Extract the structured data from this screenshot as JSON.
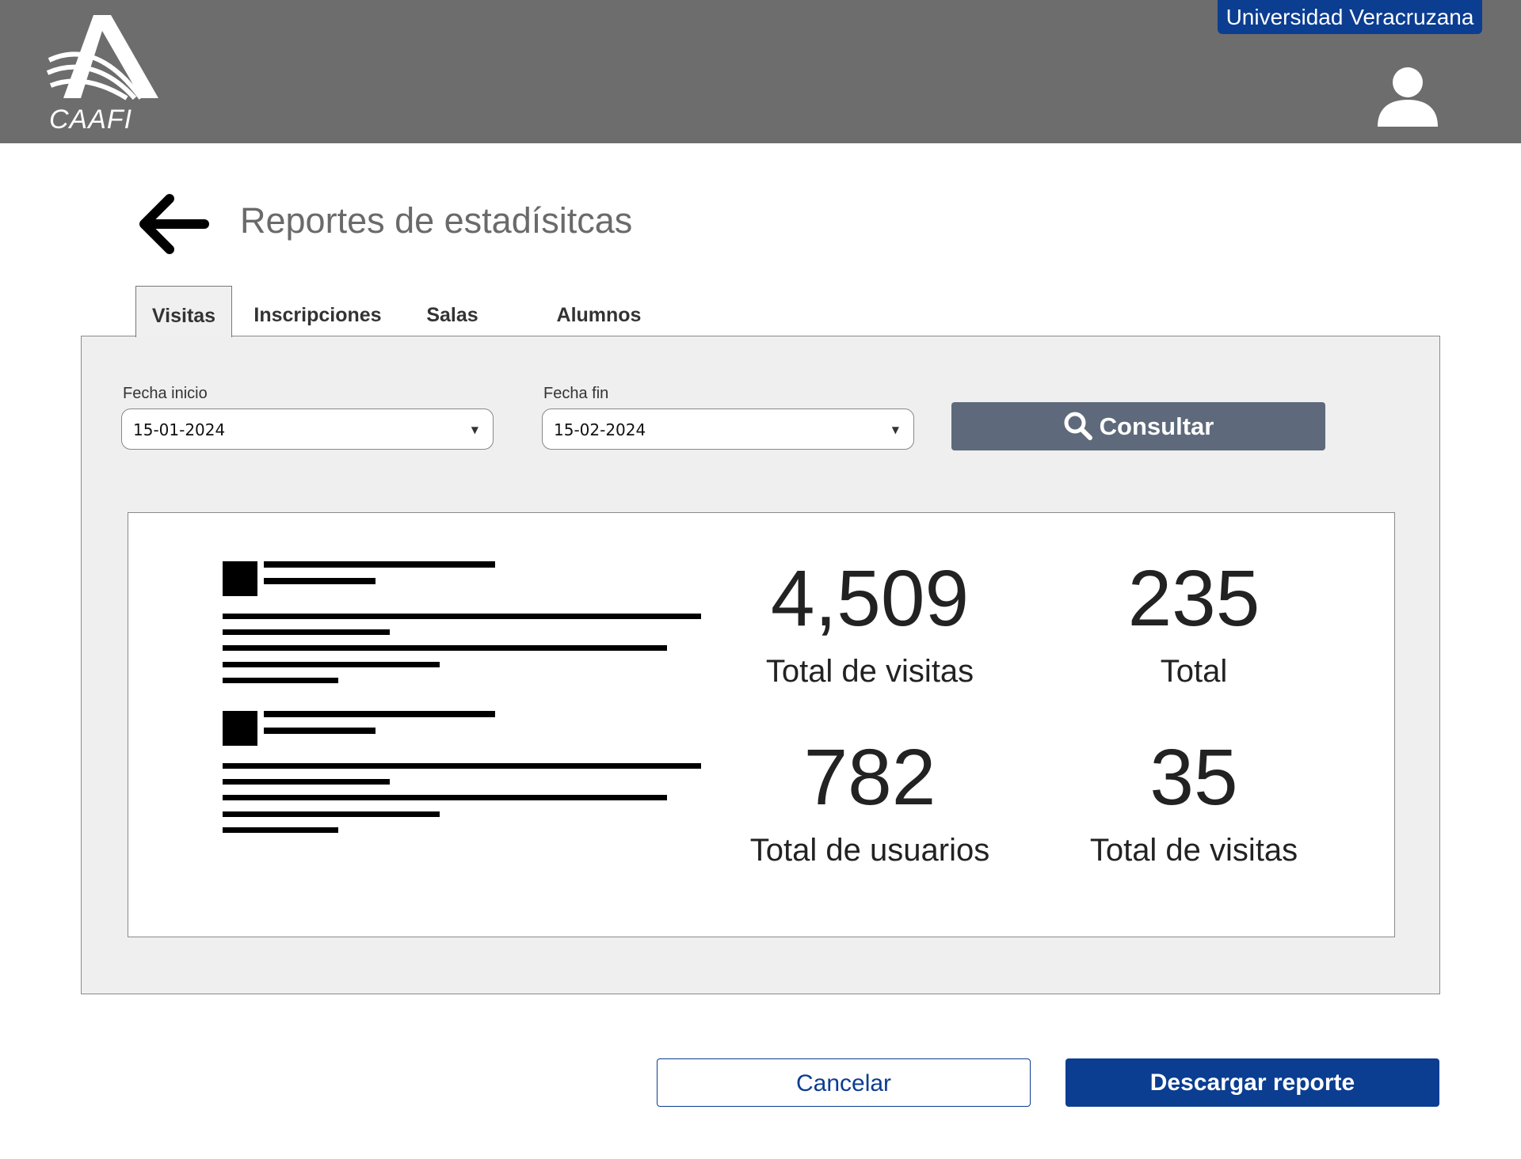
{
  "header": {
    "logo_text": "CAAFI",
    "university": "Universidad Veracruzana"
  },
  "page": {
    "title": "Reportes de estadísitcas"
  },
  "tabs": [
    {
      "label": "Visitas",
      "active": true
    },
    {
      "label": "Inscripciones",
      "active": false
    },
    {
      "label": "Salas",
      "active": false
    },
    {
      "label": "Alumnos",
      "active": false
    }
  ],
  "filters": {
    "start_label": "Fecha inicio",
    "start_value": "15-01-2024",
    "end_label": "Fecha fin",
    "end_value": "15-02-2024",
    "consult_label": "Consultar"
  },
  "stats": [
    {
      "value": "4,509",
      "label": "Total de visitas"
    },
    {
      "value": "235",
      "label": "Total"
    },
    {
      "value": "782",
      "label": "Total de usuarios"
    },
    {
      "value": "35",
      "label": "Total de visitas"
    }
  ],
  "actions": {
    "cancel": "Cancelar",
    "download": "Descargar reporte"
  },
  "colors": {
    "header_bg": "#6d6d6d",
    "brand_blue": "#0b3d91",
    "consult_bg": "#5e6a7b",
    "panel_bg": "#efefef"
  }
}
